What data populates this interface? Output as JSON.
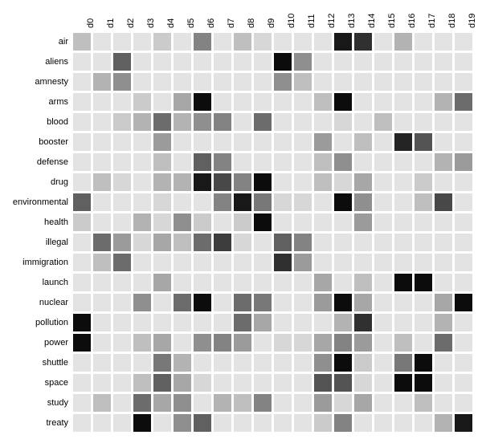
{
  "chart_data": {
    "type": "heatmap",
    "title": "",
    "xlabel": "",
    "ylabel": "",
    "columns": [
      "d0",
      "d1",
      "d2",
      "d3",
      "d4",
      "d5",
      "d6",
      "d7",
      "d8",
      "d9",
      "d10",
      "d11",
      "d12",
      "d13",
      "d14",
      "d15",
      "d16",
      "d17",
      "d18",
      "d19"
    ],
    "rows": [
      "air",
      "aliens",
      "amnesty",
      "arms",
      "blood",
      "booster",
      "defense",
      "drug",
      "environmental",
      "health",
      "illegal",
      "immigration",
      "launch",
      "nuclear",
      "pollution",
      "power",
      "shuttle",
      "space",
      "study",
      "treaty"
    ],
    "value_scale": {
      "min": 0,
      "max": 100,
      "note": "0 = very light grey (~#efefef), 100 = black"
    },
    "values": [
      [
        20,
        5,
        5,
        5,
        15,
        5,
        45,
        5,
        20,
        10,
        5,
        5,
        5,
        90,
        80,
        5,
        25,
        5,
        5,
        5
      ],
      [
        5,
        5,
        60,
        5,
        5,
        5,
        5,
        5,
        5,
        5,
        95,
        40,
        5,
        5,
        5,
        5,
        5,
        5,
        5,
        5
      ],
      [
        5,
        25,
        40,
        5,
        5,
        5,
        5,
        5,
        5,
        5,
        40,
        20,
        5,
        5,
        5,
        5,
        5,
        5,
        5,
        5
      ],
      [
        5,
        5,
        5,
        15,
        5,
        30,
        95,
        5,
        5,
        5,
        5,
        5,
        20,
        95,
        5,
        5,
        5,
        5,
        25,
        55
      ],
      [
        5,
        5,
        15,
        25,
        55,
        25,
        40,
        45,
        5,
        55,
        5,
        5,
        5,
        10,
        5,
        20,
        5,
        5,
        5,
        5
      ],
      [
        5,
        5,
        5,
        5,
        35,
        5,
        5,
        5,
        5,
        5,
        5,
        5,
        35,
        5,
        20,
        5,
        85,
        65,
        5,
        5
      ],
      [
        5,
        5,
        5,
        5,
        20,
        5,
        60,
        45,
        5,
        5,
        5,
        5,
        20,
        40,
        5,
        5,
        5,
        5,
        25,
        35
      ],
      [
        5,
        20,
        10,
        5,
        25,
        25,
        90,
        70,
        45,
        95,
        5,
        5,
        20,
        10,
        30,
        5,
        5,
        15,
        5,
        5
      ],
      [
        60,
        5,
        5,
        5,
        10,
        5,
        5,
        45,
        90,
        50,
        10,
        10,
        5,
        95,
        40,
        5,
        5,
        20,
        70,
        5
      ],
      [
        15,
        5,
        5,
        25,
        10,
        40,
        15,
        5,
        15,
        95,
        5,
        5,
        5,
        5,
        35,
        5,
        5,
        5,
        5,
        5
      ],
      [
        5,
        55,
        35,
        10,
        30,
        20,
        55,
        75,
        10,
        5,
        60,
        45,
        5,
        5,
        5,
        5,
        5,
        5,
        5,
        5
      ],
      [
        5,
        20,
        55,
        5,
        5,
        5,
        5,
        5,
        5,
        5,
        80,
        35,
        5,
        5,
        5,
        5,
        5,
        5,
        5,
        5
      ],
      [
        5,
        5,
        5,
        5,
        30,
        5,
        5,
        5,
        5,
        5,
        5,
        5,
        30,
        5,
        20,
        5,
        95,
        95,
        5,
        5
      ],
      [
        5,
        5,
        5,
        40,
        5,
        55,
        95,
        5,
        55,
        50,
        5,
        5,
        35,
        95,
        30,
        5,
        5,
        5,
        30,
        95
      ],
      [
        95,
        5,
        5,
        5,
        5,
        5,
        5,
        5,
        55,
        30,
        5,
        5,
        5,
        25,
        80,
        5,
        5,
        5,
        25,
        5
      ],
      [
        95,
        5,
        5,
        20,
        30,
        5,
        40,
        45,
        35,
        5,
        10,
        10,
        30,
        45,
        35,
        5,
        20,
        5,
        55,
        5
      ],
      [
        5,
        5,
        5,
        5,
        50,
        25,
        5,
        5,
        5,
        5,
        5,
        5,
        40,
        95,
        15,
        5,
        50,
        95,
        5,
        5
      ],
      [
        5,
        5,
        5,
        20,
        60,
        30,
        10,
        5,
        5,
        5,
        5,
        5,
        65,
        65,
        10,
        5,
        95,
        95,
        5,
        5
      ],
      [
        5,
        20,
        5,
        55,
        30,
        40,
        5,
        25,
        20,
        45,
        5,
        5,
        35,
        10,
        30,
        5,
        5,
        20,
        5,
        5
      ],
      [
        5,
        5,
        5,
        95,
        5,
        40,
        60,
        5,
        5,
        5,
        5,
        5,
        15,
        45,
        5,
        5,
        5,
        5,
        25,
        90
      ]
    ]
  }
}
